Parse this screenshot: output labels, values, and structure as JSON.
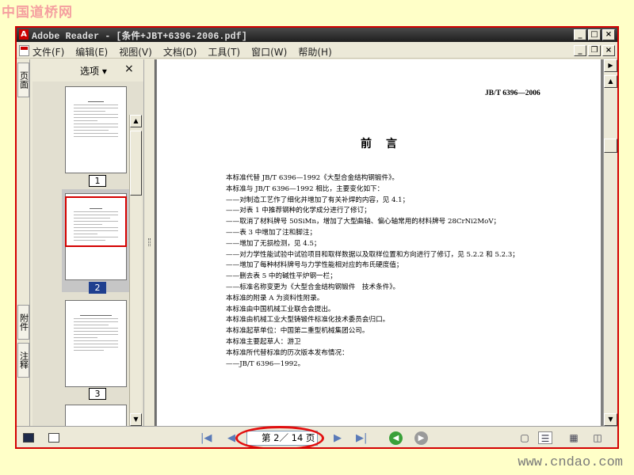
{
  "watermark": {
    "top": "中国道桥网",
    "bottom": "www.cndao.com"
  },
  "window": {
    "title": "Adobe Reader - [条件+JBT+6396-2006.pdf]"
  },
  "menu": [
    "文件(F)",
    "编辑(E)",
    "视图(V)",
    "文档(D)",
    "工具(T)",
    "窗口(W)",
    "帮助(H)"
  ],
  "side_tabs": {
    "pages": "页面",
    "attachments": "附件",
    "comments": "注释"
  },
  "thumb_panel": {
    "options": "选项 ▾",
    "close": "×"
  },
  "thumbnails": [
    {
      "label": "1",
      "selected": false
    },
    {
      "label": "2",
      "selected": true
    },
    {
      "label": "3",
      "selected": false
    }
  ],
  "document": {
    "standard_id": "JB/T 6396—2006",
    "heading": "前言",
    "lines": [
      "本标准代替 JB/T 6396—1992《大型合金结构钢锻件》。",
      "本标准与 JB/T 6396—1992 相比，主要变化如下：",
      "——对制造工艺作了细化并增加了有关补焊的内容，见 4.1；",
      "——对表 1 中推荐钢种的化学成分进行了修订；",
      "——取消了材料牌号 50SiMn，增加了大型曲轴、偏心轴常用的材料牌号 28CrNi2MoV；",
      "——表 3 中增加了注和脚注；",
      "——增加了无损检测，见 4.5；",
      "——对力学性能试验中试验项目和取样数据以及取样位置和方向进行了修订，见 5.2.2 和 5.2.3；",
      "——增加了每种材料牌号与力学性能相对应的布氏硬度值；",
      "——删去表 5 中的碱性平炉钢一栏；",
      "——标准名称变更为《大型合金结构钢锻件　技术条件》。",
      "本标准的附录 A 为资料性附录。",
      "本标准由中国机械工业联合会提出。",
      "本标准由机械工业大型铸锻件标准化技术委员会归口。",
      "本标准起草单位：中国第二重型机械集团公司。",
      "本标准主要起草人：游卫",
      "本标准所代替标准的历次版本发布情况：",
      "——JB/T 6396—1992。"
    ]
  },
  "statusbar": {
    "page_indicator": "第 2／ 14 页",
    "current_page": 2,
    "total_pages": 14
  },
  "colors": {
    "highlight": "#d40000",
    "titlebar": "#2a2a2a",
    "selected_thumb_label": "#1f3f8f"
  }
}
